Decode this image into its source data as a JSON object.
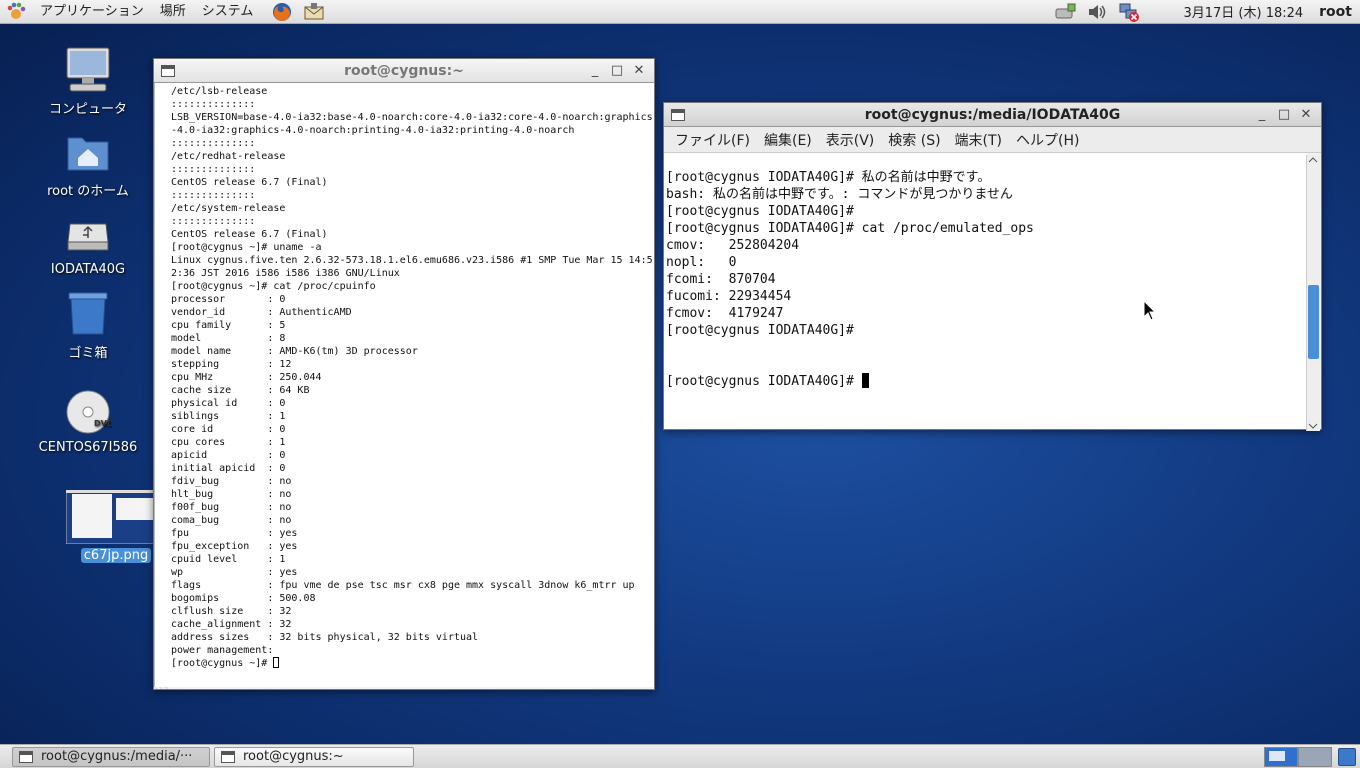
{
  "top_panel": {
    "menus": [
      "アプリケーション",
      "場所",
      "システム"
    ],
    "clock": "3月17日 (木) 18:24",
    "user": "root"
  },
  "desktop_icons": [
    {
      "label": "コンピュータ",
      "icon": "computer-icon"
    },
    {
      "label": "root のホーム",
      "icon": "home-folder-icon"
    },
    {
      "label": "IODATA40G",
      "icon": "usb-drive-icon"
    },
    {
      "label": "ゴミ箱",
      "icon": "trash-icon"
    },
    {
      "label": "CENTOS67I586",
      "icon": "dvd-icon"
    },
    {
      "label": "c67jp.png",
      "icon": "image-thumbnail-icon"
    }
  ],
  "left_terminal": {
    "title": "root@cygnus:~",
    "buttons": [
      "_",
      "□",
      "✕"
    ],
    "content": "/etc/lsb-release\n::::::::::::::\nLSB_VERSION=base-4.0-ia32:base-4.0-noarch:core-4.0-ia32:core-4.0-noarch:graphics\n-4.0-ia32:graphics-4.0-noarch:printing-4.0-ia32:printing-4.0-noarch\n::::::::::::::\n/etc/redhat-release\n::::::::::::::\nCentOS release 6.7 (Final)\n::::::::::::::\n/etc/system-release\n::::::::::::::\nCentOS release 6.7 (Final)\n[root@cygnus ~]# uname -a\nLinux cygnus.five.ten 2.6.32-573.18.1.el6.emu686.v23.i586 #1 SMP Tue Mar 15 14:5\n2:36 JST 2016 i586 i586 i386 GNU/Linux\n[root@cygnus ~]# cat /proc/cpuinfo\nprocessor       : 0\nvendor_id       : AuthenticAMD\ncpu family      : 5\nmodel           : 8\nmodel name      : AMD-K6(tm) 3D processor\nstepping        : 12\ncpu MHz         : 250.044\ncache size      : 64 KB\nphysical id     : 0\nsiblings        : 1\ncore id         : 0\ncpu cores       : 1\napicid          : 0\ninitial apicid  : 0\nfdiv_bug        : no\nhlt_bug         : no\nf00f_bug        : no\ncoma_bug        : no\nfpu             : yes\nfpu_exception   : yes\ncpuid level     : 1\nwp              : yes\nflags           : fpu vme de pse tsc msr cx8 pge mmx syscall 3dnow k6_mtrr up\nbogomips        : 500.08\nclflush size    : 32\ncache_alignment : 32\naddress sizes   : 32 bits physical, 32 bits virtual\npower management:\n",
    "prompt": "[root@cygnus ~]# "
  },
  "right_terminal": {
    "title": "root@cygnus:/media/IODATA40G",
    "buttons": [
      "_",
      "□",
      "✕"
    ],
    "menus": [
      "ファイル(F)",
      "編集(E)",
      "表示(V)",
      "検索 (S)",
      "端末(T)",
      "ヘルプ(H)"
    ],
    "content": "[root@cygnus IODATA40G]# 私の名前は中野です。\nbash: 私の名前は中野です。: コマンドが見つかりません\n[root@cygnus IODATA40G]#\n[root@cygnus IODATA40G]# cat /proc/emulated_ops\ncmov:   252804204\nnopl:   0\nfcomi:  870704\nfucomi: 22934454\nfcmov:  4179247\n[root@cygnus IODATA40G]#\n\n\n",
    "prompt": "[root@cygnus IODATA40G]# "
  },
  "taskbar": {
    "tasks": [
      "root@cygnus:/media/···",
      "root@cygnus:~"
    ]
  }
}
